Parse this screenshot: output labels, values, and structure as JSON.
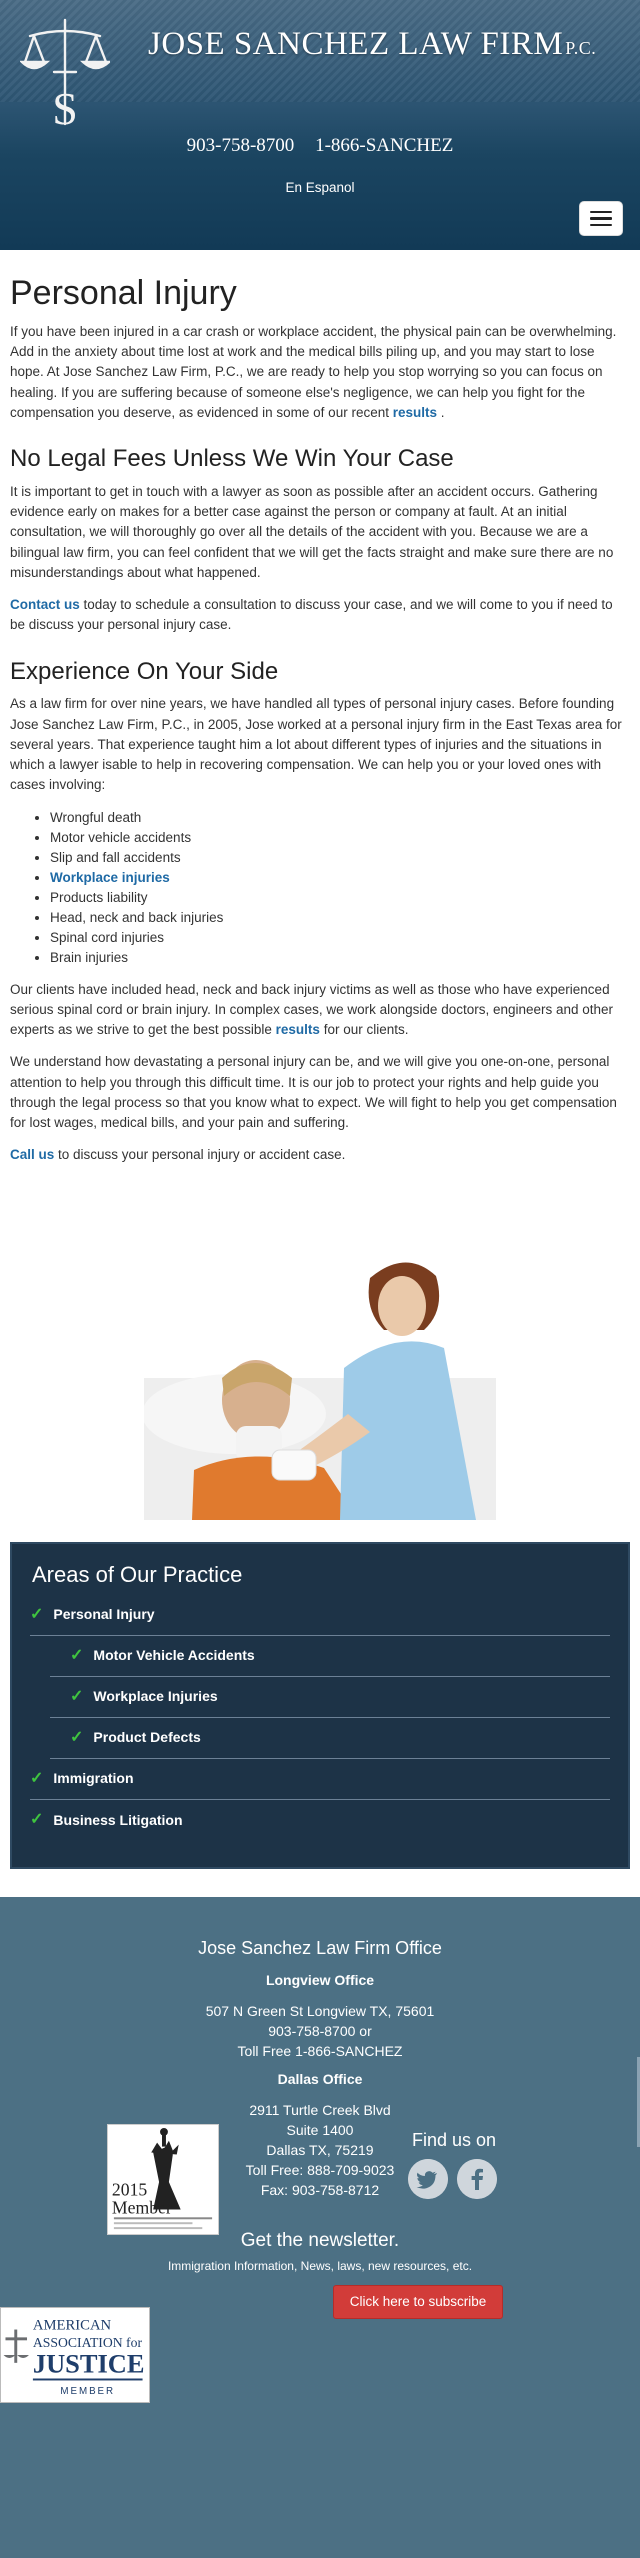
{
  "header": {
    "firm_name": "JOSE SANCHEZ LAW FIRM",
    "firm_suffix": "P.C.",
    "logo_letter": "S",
    "phone_local": "903-758-8700",
    "phone_tollfree": "1-866-SANCHEZ",
    "language_link": "En Espanol"
  },
  "content": {
    "title": "Personal Injury",
    "intro_text": "If you have been injured in a car crash or workplace accident, the physical pain can be overwhelming. Add in the anxiety about time lost at work and the medical bills piling up, and you may start to lose hope. At Jose Sanchez Law Firm, P.C., we are ready to help you stop worrying so you can focus on healing. If you are suffering because of someone else's negligence, we can help you fight for the compensation you deserve, as evidenced in some of our recent",
    "intro_link": "results",
    "intro_end": ".",
    "section1_heading": "No Legal Fees Unless We Win Your Case",
    "section1_text": "It is important to get in touch with a lawyer as soon as possible after an accident occurs. Gathering evidence early on makes for a better case against the person or company at fault. At an initial consultation, we will thoroughly go over all the details of the accident with you. Because we are a bilingual law firm, you can feel confident that we will get the facts straight and make sure there are no misunderstandings about what happened.",
    "contact_link": "Contact us",
    "contact_text": "today to schedule a consultation to discuss your case, and we will come to you if need to be discuss your personal injury case.",
    "section2_heading": "Experience On Your Side",
    "section2_text": "As a law firm for over nine years, we have handled all types of personal injury cases. Before founding Jose Sanchez Law Firm, P.C., in 2005, Jose worked at a personal injury firm in the East Texas area for several years. That experience taught him a lot about different types of injuries and the situations in which a lawyer isable to help in recovering compensation. We can help you or your loved ones with cases involving:",
    "injury_types": [
      {
        "label": "Wrongful death",
        "link": false
      },
      {
        "label": "Motor vehicle accidents",
        "link": false
      },
      {
        "label": "Slip and fall accidents",
        "link": false
      },
      {
        "label": "Workplace injuries",
        "link": true
      },
      {
        "label": "Products liability",
        "link": false
      },
      {
        "label": "Head, neck and back injuries",
        "link": false
      },
      {
        "label": "Spinal cord injuries",
        "link": false
      },
      {
        "label": "Brain injuries",
        "link": false
      }
    ],
    "clients_text": "Our clients have included head, neck and back injury victims as well as those who have experienced serious spinal cord or brain injury. In complex cases, we work alongside doctors, engineers and other experts as we strive to get the best possible",
    "clients_link": "results",
    "clients_end": "for our clients.",
    "understand_text": "We understand how devastating a personal injury can be, and we will give you one-on-one, personal attention to help you through this difficult time. It is our job to protect your rights and help guide you through the legal process so that you know what to expect. We will fight to help you get compensation for lost wages, medical bills, and your pain and suffering.",
    "call_link": "Call us",
    "call_text": "to discuss your personal injury or accident case."
  },
  "practice": {
    "heading": "Areas of Our Practice",
    "items": [
      {
        "label": "Personal Injury",
        "sub": false
      },
      {
        "label": "Motor Vehicle Accidents",
        "sub": true
      },
      {
        "label": "Workplace Injuries",
        "sub": true
      },
      {
        "label": "Product Defects",
        "sub": true
      },
      {
        "label": "Immigration",
        "sub": false
      },
      {
        "label": "Business Litigation",
        "sub": false
      }
    ]
  },
  "footer": {
    "office_title": "Jose Sanchez Law Firm Office",
    "longview_label": "Longview Office",
    "longview_address": "507 N Green St Longview TX, 75601",
    "longview_phone": "903-758-8700 or",
    "longview_tollfree": "Toll Free 1-866-SANCHEZ",
    "dallas_label": "Dallas Office",
    "dallas_street": "2911 Turtle Creek Blvd",
    "dallas_suite": "Suite 1400",
    "dallas_city": "Dallas TX, 75219",
    "dallas_tollfree": "Toll Free: 888-709-9023",
    "dallas_fax": "Fax: 903-758-8712",
    "member_year": "2015",
    "member_word": "Member",
    "find_us": "Find us on",
    "newsletter_title": "Get the newsletter.",
    "newsletter_text": "Immigration Information, News, laws, new resources, etc.",
    "subscribe_label": "Click here to subscribe",
    "aaj_line1": "AMERICAN",
    "aaj_line2": "ASSOCIATION for",
    "aaj_line3": "JUSTICE",
    "aaj_line4": "MEMBER"
  },
  "colors": {
    "header_dark": "#123a56",
    "link_blue": "#1f6aa5",
    "practice_bg": "#1d3347",
    "check_green": "#3fc43f",
    "footer_bg": "#4c7084",
    "subscribe_red": "#d23c39"
  }
}
